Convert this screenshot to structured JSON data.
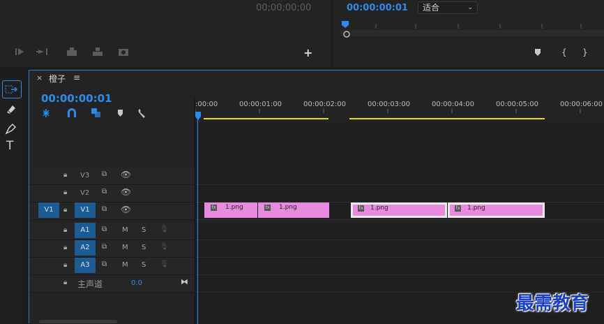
{
  "source_monitor": {
    "timecode": "00;00;00;00"
  },
  "program_monitor": {
    "timecode": "00:00:00:01",
    "zoom_select": "适合"
  },
  "timeline": {
    "tab_title": "橙子",
    "close_label": "×",
    "menu_label": "≡",
    "playhead_timecode": "00:00:00:01",
    "ruler_labels": [
      ":00:00",
      "00:00:01:00",
      "00:00:02:00",
      "00:00:03:00",
      "00:00:04:00",
      "00:00:05:00",
      "00:00:06:00"
    ],
    "video_tracks": [
      {
        "name": "V3"
      },
      {
        "name": "V2"
      },
      {
        "name": "V1",
        "source_target": "V1"
      }
    ],
    "audio_tracks": [
      {
        "name": "A1",
        "m": "M",
        "s": "S"
      },
      {
        "name": "A2",
        "m": "M",
        "s": "S"
      },
      {
        "name": "A3",
        "m": "M",
        "s": "S"
      }
    ],
    "master": {
      "label": "主声道",
      "value": "0.0"
    },
    "clips": [
      {
        "name": "1.png",
        "fx": "fx"
      },
      {
        "name": "1.png",
        "fx": "fx"
      },
      {
        "name": "1.png",
        "fx": "fx"
      },
      {
        "name": "1.png",
        "fx": "fx"
      }
    ]
  },
  "watermark": "最需教育",
  "colors": {
    "accent": "#2d8ceb",
    "clip": "#e88ae0",
    "work_area": "#e8e000",
    "target": "#1c5b93"
  }
}
